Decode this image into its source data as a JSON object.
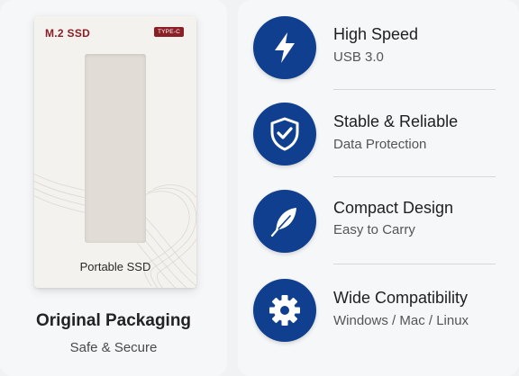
{
  "packaging": {
    "brand": "M.2 SSD",
    "badge": "TYPE-C",
    "box_label": "Portable SSD",
    "title": "Original Packaging",
    "subtitle": "Safe & Secure"
  },
  "features": [
    {
      "icon": "lightning-icon",
      "title": "High Speed",
      "subtitle": "USB 3.0"
    },
    {
      "icon": "shield-check-icon",
      "title": "Stable & Reliable",
      "subtitle": "Data Protection"
    },
    {
      "icon": "feather-icon",
      "title": "Compact Design",
      "subtitle": "Easy to Carry"
    },
    {
      "icon": "gear-icon",
      "title": "Wide Compatibility",
      "subtitle": "Windows / Mac / Linux"
    }
  ],
  "colors": {
    "accent": "#0f3f8e",
    "brand_red": "#8a1f26"
  }
}
